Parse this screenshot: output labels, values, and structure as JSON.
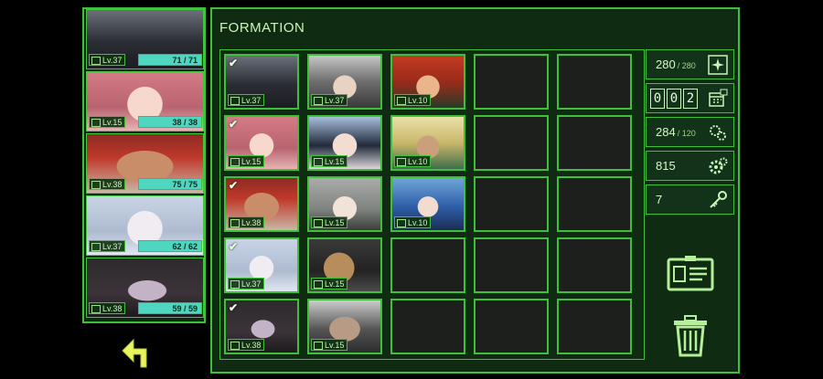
{
  "roster": [
    {
      "level": "Lv.37",
      "hp": "71 / 71",
      "hp_fraction": 1.0,
      "portrait": "soldier-gasmask",
      "role_icon": "rifle-icon"
    },
    {
      "level": "Lv.15",
      "hp": "38 / 38",
      "hp_fraction": 1.0,
      "portrait": "pink-hair-girl",
      "role_icon": "shield-icon"
    },
    {
      "level": "Lv.38",
      "hp": "75 / 75",
      "hp_fraction": 1.0,
      "portrait": "red-mask-man",
      "role_icon": "wrench-icon"
    },
    {
      "level": "Lv.37",
      "hp": "62 / 62",
      "hp_fraction": 1.0,
      "portrait": "silver-hair-girl",
      "role_icon": "cap-icon"
    },
    {
      "level": "Lv.38",
      "hp": "59 / 59",
      "hp_fraction": 1.0,
      "portrait": "hooded-figure",
      "role_icon": "hand-icon"
    }
  ],
  "formation": {
    "title": "FORMATION",
    "rows": [
      [
        {
          "level": "Lv.37",
          "checked": true,
          "portrait": "soldier-gasmask"
        },
        {
          "level": "Lv.37",
          "checked": false,
          "portrait": "goggle-girl"
        },
        {
          "level": "Lv.10",
          "checked": false,
          "portrait": "red-hair-warrior"
        },
        null,
        null
      ],
      [
        {
          "level": "Lv.15",
          "checked": true,
          "portrait": "pink-hair-girl"
        },
        {
          "level": "Lv.15",
          "checked": false,
          "portrait": "glasses-woman"
        },
        {
          "level": "Lv.10",
          "checked": false,
          "portrait": "blonde-girl"
        },
        null,
        null
      ],
      [
        {
          "level": "Lv.38",
          "checked": true,
          "portrait": "red-mask-man"
        },
        {
          "level": "Lv.15",
          "checked": false,
          "portrait": "grey-hair-girl"
        },
        {
          "level": "Lv.10",
          "checked": false,
          "portrait": "blue-hair-girl"
        },
        null,
        null
      ],
      [
        {
          "level": "Lv.37",
          "checked": true,
          "portrait": "silver-hair-girl"
        },
        {
          "level": "Lv.15",
          "checked": false,
          "portrait": "bear-mascot"
        },
        null,
        null,
        null
      ],
      [
        {
          "level": "Lv.38",
          "checked": true,
          "portrait": "hooded-figure"
        },
        {
          "level": "Lv.15",
          "checked": false,
          "portrait": "old-man-goggles"
        },
        null,
        null,
        null
      ]
    ]
  },
  "stats": {
    "energy": {
      "value": "280",
      "max": "/ 280",
      "icon": "sparkle-icon"
    },
    "counter": {
      "digits": [
        "0",
        "0",
        "2"
      ],
      "icon": "calendar-icon"
    },
    "supply": {
      "value": "284",
      "max": "/ 120",
      "icon": "gears-bag-icon"
    },
    "parts": {
      "value": "815",
      "icon": "gear-icon"
    },
    "keys": {
      "value": "7",
      "icon": "key-icon"
    }
  },
  "buttons": {
    "back": "back-arrow-icon",
    "card": "id-card-icon",
    "trash": "trash-icon"
  },
  "colors": {
    "accent": "#3fbf3a",
    "panel": "#0f2c13",
    "hp": "#4fd6c1"
  }
}
